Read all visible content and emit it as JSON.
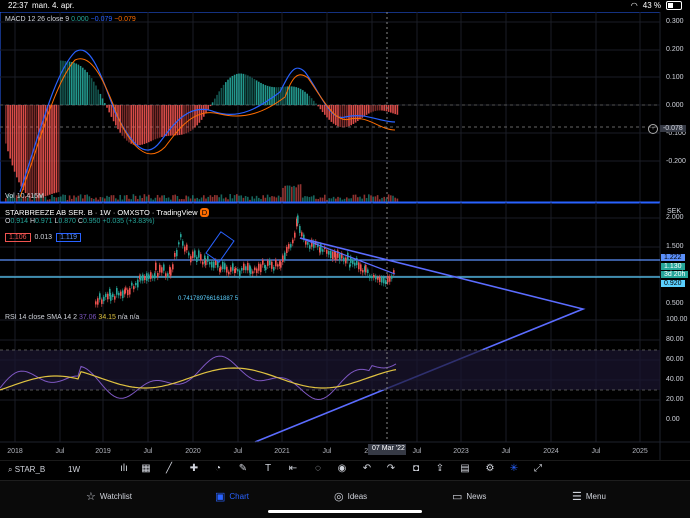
{
  "statusbar": {
    "time": "22:37",
    "date": "man. 4. apr.",
    "battery": "43 %"
  },
  "macd": {
    "title": "MACD 12 26 close 9",
    "v1": "0.000",
    "v2": "−0.079",
    "v3": "−0.079",
    "colors": {
      "hist_pos": "#26a69a",
      "hist_neg": "#ef5350",
      "macd": "#2962ff",
      "signal": "#ff6d00"
    },
    "scale": [
      "0.300",
      "0.200",
      "0.100",
      "0.000",
      "-0.100",
      "-0.200"
    ],
    "current": "-0.078"
  },
  "volume": {
    "title": "Vol",
    "value": "10.415M"
  },
  "main": {
    "title": "STARBREEZE AB SER. B",
    "interval": "1W",
    "exchange": "OMXSTO",
    "source": "TradingView",
    "badge": "D",
    "ohlc": {
      "o_label": "O",
      "o": "0.914",
      "h_label": "H",
      "h": "0.971",
      "l_label": "L",
      "l": "0.870",
      "c_label": "C",
      "c": "0.950",
      "chg": "+0.035 (+3.83%)"
    },
    "bid": "1.106",
    "spread": "0.013",
    "ask": "1.119",
    "currency": "SEK",
    "scale": [
      "2.000",
      "1.500",
      "1.000",
      "0.500"
    ],
    "tags": {
      "upper": "1.222",
      "price": "1.130",
      "countdown": "3d 20h",
      "lower": "0.920"
    },
    "annotation": "0.741789766161887 5"
  },
  "rsi": {
    "title": "RSI 14 close SMA 14 2",
    "v1": "37.06",
    "v2": "34.15",
    "v3": "n/a",
    "v4": "n/a",
    "scale": [
      "100.00",
      "80.00",
      "60.00",
      "40.00",
      "20.00",
      "0.00"
    ]
  },
  "time_axis": {
    "labels": [
      "2018",
      "Jul",
      "2019",
      "Jul",
      "2020",
      "Jul",
      "2021",
      "Jul",
      "2022",
      "Jul",
      "2023",
      "Jul",
      "2024",
      "Jul",
      "2025"
    ],
    "cursor": "07 Mar '22"
  },
  "toolbar": {
    "symbol": "STAR_B",
    "timeframe": "1W"
  },
  "tabs": [
    {
      "label": "Watchlist",
      "icon": "star-icon"
    },
    {
      "label": "Chart",
      "icon": "chart-icon"
    },
    {
      "label": "Ideas",
      "icon": "ideas-icon"
    },
    {
      "label": "News",
      "icon": "news-icon"
    },
    {
      "label": "Menu",
      "icon": "menu-icon"
    }
  ]
}
